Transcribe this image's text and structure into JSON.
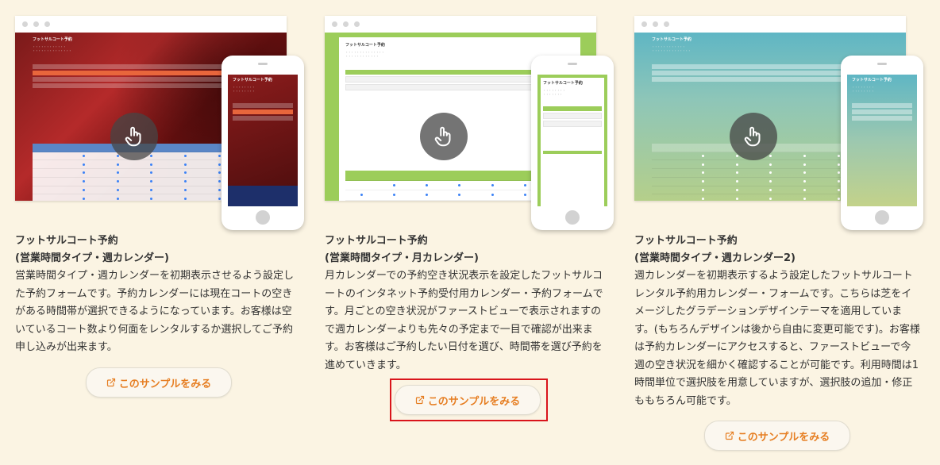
{
  "cards": [
    {
      "title": "フットサルコート予約",
      "subtitle": "(営業時間タイプ・週カレンダー)",
      "desc": "営業時間タイプ・週カレンダーを初期表示させるよう設定した予約フォームです。予約カレンダーには現在コートの空きがある時間帯が選択できるようになっています。お客様は空いているコート数より何面をレンタルするか選択してご予約申し込みが出来ます。",
      "button": "このサンプルをみる",
      "theme": "photo-red"
    },
    {
      "title": "フットサルコート予約",
      "subtitle": "(営業時間タイプ・月カレンダー)",
      "desc": "月カレンダーでの予約空き状況表示を設定したフットサルコートのインタネット予約受付用カレンダー・予約フォームです。月ごとの空き状況がファーストビューで表示されますので週カレンダーよりも先々の予定まで一目で確認が出来ます。お客様はご予約したい日付を選び、時間帯を選び予約を進めていきます。",
      "button": "このサンプルをみる",
      "theme": "green"
    },
    {
      "title": "フットサルコート予約",
      "subtitle": "(営業時間タイプ・週カレンダー2)",
      "desc": "週カレンダーを初期表示するよう設定したフットサルコートレンタル予約用カレンダー・フォームです。こちらは芝をイメージしたグラデーションデザインテーマを適用しています。(もちろんデザインは後から自由に変更可能です)。お客様は予約カレンダーにアクセスすると、ファーストビューで今週の空き状況を細かく確認することが可能です。利用時間は1時間単位で選択肢を用意していますが、選択肢の追加・修正ももちろん可能です。",
      "button": "このサンプルをみる",
      "theme": "gradient"
    }
  ],
  "preview": {
    "form_title": "フットサルコート予約",
    "icons": [
      "pointer-hand-icon",
      "external-link-icon"
    ]
  },
  "colors": {
    "background": "#fbf4e3",
    "accent": "#e67e22",
    "highlight": "#d9141b",
    "green_theme": "#9ccd5a"
  }
}
